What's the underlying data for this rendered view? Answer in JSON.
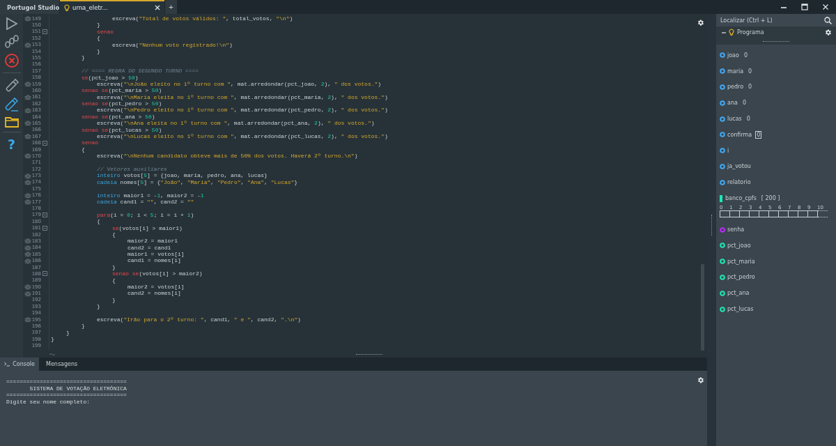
{
  "tabs": [
    {
      "label": "Portugol Studio",
      "kind": "home",
      "selected": false,
      "closable": false
    },
    {
      "label": "urna_eletr...",
      "kind": "file",
      "selected": true,
      "closable": true
    }
  ],
  "new_tab_label": "+",
  "toolbar": {
    "help_label": "?"
  },
  "editor": {
    "lines": [
      {
        "number": "149",
        "breakpoint": true,
        "fold": false,
        "tokens": [
          {
            "kind": "plain",
            "text": "\t\t\t\tescreva("
          },
          {
            "kind": "str",
            "text": "\"Total de votos válidos: \""
          },
          {
            "kind": "plain",
            "text": ", total_votos, "
          },
          {
            "kind": "str",
            "text": "\"\\n\""
          },
          {
            "kind": "plain",
            "text": ")"
          }
        ]
      },
      {
        "number": "150",
        "breakpoint": false,
        "fold": false,
        "tokens": [
          {
            "kind": "plain",
            "text": "\t\t\t}"
          }
        ]
      },
      {
        "number": "151",
        "breakpoint": false,
        "fold": true,
        "tokens": [
          {
            "kind": "kw",
            "text": "\t\t\tsenao"
          }
        ]
      },
      {
        "number": "152",
        "breakpoint": false,
        "fold": false,
        "tokens": [
          {
            "kind": "plain",
            "text": "\t\t\t{"
          }
        ]
      },
      {
        "number": "153",
        "breakpoint": true,
        "fold": false,
        "tokens": [
          {
            "kind": "plain",
            "text": "\t\t\t\tescreva("
          },
          {
            "kind": "str",
            "text": "\"Nenhum voto registrado!\\n\""
          },
          {
            "kind": "plain",
            "text": ")"
          }
        ]
      },
      {
        "number": "154",
        "breakpoint": false,
        "fold": false,
        "tokens": [
          {
            "kind": "plain",
            "text": "\t\t\t}"
          }
        ]
      },
      {
        "number": "155",
        "breakpoint": false,
        "fold": false,
        "tokens": [
          {
            "kind": "plain",
            "text": "\t\t}"
          }
        ]
      },
      {
        "number": "156",
        "breakpoint": false,
        "fold": false
      },
      {
        "number": "157",
        "breakpoint": false,
        "fold": false,
        "tokens": [
          {
            "kind": "comment",
            "text": "\t\t// ==== REGRA DO SEGUNDO TURNO ===="
          }
        ]
      },
      {
        "number": "158",
        "breakpoint": false,
        "fold": false,
        "tokens": [
          {
            "kind": "kw",
            "text": "\t\tse"
          },
          {
            "kind": "plain",
            "text": "(pct_joao > "
          },
          {
            "kind": "num",
            "text": "50"
          },
          {
            "kind": "plain",
            "text": ")"
          }
        ]
      },
      {
        "number": "159",
        "breakpoint": true,
        "fold": false,
        "tokens": [
          {
            "kind": "plain",
            "text": "\t\t\tescreva("
          },
          {
            "kind": "str",
            "text": "\"\\nJoão eleito no 1º turno com \""
          },
          {
            "kind": "plain",
            "text": ", mat.arredondar(pct_joao, "
          },
          {
            "kind": "num",
            "text": "2"
          },
          {
            "kind": "plain",
            "text": "), "
          },
          {
            "kind": "str",
            "text": "\" dos votos.\""
          },
          {
            "kind": "plain",
            "text": ")"
          }
        ]
      },
      {
        "number": "160",
        "breakpoint": false,
        "fold": false,
        "tokens": [
          {
            "kind": "kw",
            "text": "\t\tsenao se"
          },
          {
            "kind": "plain",
            "text": "(pct_maria > "
          },
          {
            "kind": "num",
            "text": "50"
          },
          {
            "kind": "plain",
            "text": ")"
          }
        ]
      },
      {
        "number": "161",
        "breakpoint": true,
        "fold": false,
        "tokens": [
          {
            "kind": "plain",
            "text": "\t\t\tescreva("
          },
          {
            "kind": "str",
            "text": "\"\\nMaria eleita no 1º turno com \""
          },
          {
            "kind": "plain",
            "text": ", mat.arredondar(pct_maria, "
          },
          {
            "kind": "num",
            "text": "2"
          },
          {
            "kind": "plain",
            "text": "), "
          },
          {
            "kind": "str",
            "text": "\" dos votos.\""
          },
          {
            "kind": "plain",
            "text": ")"
          }
        ]
      },
      {
        "number": "162",
        "breakpoint": false,
        "fold": false,
        "tokens": [
          {
            "kind": "kw",
            "text": "\t\tsenao se"
          },
          {
            "kind": "plain",
            "text": "(pct_pedro > "
          },
          {
            "kind": "num",
            "text": "50"
          },
          {
            "kind": "plain",
            "text": ")"
          }
        ]
      },
      {
        "number": "163",
        "breakpoint": true,
        "fold": false,
        "tokens": [
          {
            "kind": "plain",
            "text": "\t\t\tescreva("
          },
          {
            "kind": "str",
            "text": "\"\\nPedro eleito no 1º turno com \""
          },
          {
            "kind": "plain",
            "text": ", mat.arredondar(pct_pedro, "
          },
          {
            "kind": "num",
            "text": "2"
          },
          {
            "kind": "plain",
            "text": "), "
          },
          {
            "kind": "str",
            "text": "\" dos votos.\""
          },
          {
            "kind": "plain",
            "text": ")"
          }
        ]
      },
      {
        "number": "164",
        "breakpoint": false,
        "fold": false,
        "tokens": [
          {
            "kind": "kw",
            "text": "\t\tsenao se"
          },
          {
            "kind": "plain",
            "text": "(pct_ana > "
          },
          {
            "kind": "num",
            "text": "50"
          },
          {
            "kind": "plain",
            "text": ")"
          }
        ]
      },
      {
        "number": "165",
        "breakpoint": true,
        "fold": false,
        "tokens": [
          {
            "kind": "plain",
            "text": "\t\t\tescreva("
          },
          {
            "kind": "str",
            "text": "\"\\nAna eleita no 1º turno com \""
          },
          {
            "kind": "plain",
            "text": ", mat.arredondar(pct_ana, "
          },
          {
            "kind": "num",
            "text": "2"
          },
          {
            "kind": "plain",
            "text": "), "
          },
          {
            "kind": "str",
            "text": "\" dos votos.\""
          },
          {
            "kind": "plain",
            "text": ")"
          }
        ]
      },
      {
        "number": "166",
        "breakpoint": false,
        "fold": false,
        "tokens": [
          {
            "kind": "kw",
            "text": "\t\tsenao se"
          },
          {
            "kind": "plain",
            "text": "(pct_lucas > "
          },
          {
            "kind": "num",
            "text": "50"
          },
          {
            "kind": "plain",
            "text": ")"
          }
        ]
      },
      {
        "number": "167",
        "breakpoint": true,
        "fold": false,
        "tokens": [
          {
            "kind": "plain",
            "text": "\t\t\tescreva("
          },
          {
            "kind": "str",
            "text": "\"\\nLucas eleito no 1º turno com \""
          },
          {
            "kind": "plain",
            "text": ", mat.arredondar(pct_lucas, "
          },
          {
            "kind": "num",
            "text": "2"
          },
          {
            "kind": "plain",
            "text": "), "
          },
          {
            "kind": "str",
            "text": "\" dos votos.\""
          },
          {
            "kind": "plain",
            "text": ")"
          }
        ]
      },
      {
        "number": "168",
        "breakpoint": false,
        "fold": true,
        "tokens": [
          {
            "kind": "kw",
            "text": "\t\tsenao"
          }
        ]
      },
      {
        "number": "169",
        "breakpoint": false,
        "fold": false,
        "tokens": [
          {
            "kind": "plain",
            "text": "\t\t{"
          }
        ]
      },
      {
        "number": "170",
        "breakpoint": true,
        "fold": false,
        "tokens": [
          {
            "kind": "plain",
            "text": "\t\t\tescreva("
          },
          {
            "kind": "str",
            "text": "\"\\nNenhum candidato obteve mais de 50% dos votos. Haverá 2º turno.\\n\""
          },
          {
            "kind": "plain",
            "text": ")"
          }
        ]
      },
      {
        "number": "171",
        "breakpoint": false,
        "fold": false
      },
      {
        "number": "172",
        "breakpoint": false,
        "fold": false,
        "tokens": [
          {
            "kind": "comment",
            "text": "\t\t\t// Vetores auxiliares"
          }
        ]
      },
      {
        "number": "173",
        "breakpoint": true,
        "fold": false,
        "tokens": [
          {
            "kind": "type",
            "text": "\t\t\tinteiro"
          },
          {
            "kind": "plain",
            "text": " votos["
          },
          {
            "kind": "num",
            "text": "5"
          },
          {
            "kind": "plain",
            "text": "] = {joao, maria, pedro, ana, lucas}"
          }
        ]
      },
      {
        "number": "174",
        "breakpoint": true,
        "fold": false,
        "tokens": [
          {
            "kind": "type",
            "text": "\t\t\tcadeia"
          },
          {
            "kind": "plain",
            "text": " nomes["
          },
          {
            "kind": "num",
            "text": "5"
          },
          {
            "kind": "plain",
            "text": "] = {"
          },
          {
            "kind": "str",
            "text": "\"João\""
          },
          {
            "kind": "plain",
            "text": ", "
          },
          {
            "kind": "str",
            "text": "\"Maria\""
          },
          {
            "kind": "plain",
            "text": ", "
          },
          {
            "kind": "str",
            "text": "\"Pedro\""
          },
          {
            "kind": "plain",
            "text": ", "
          },
          {
            "kind": "str",
            "text": "\"Ana\""
          },
          {
            "kind": "plain",
            "text": ", "
          },
          {
            "kind": "str",
            "text": "\"Lucas\""
          },
          {
            "kind": "plain",
            "text": "}"
          }
        ]
      },
      {
        "number": "175",
        "breakpoint": false,
        "fold": false
      },
      {
        "number": "176",
        "breakpoint": true,
        "fold": false,
        "tokens": [
          {
            "kind": "type",
            "text": "\t\t\tinteiro"
          },
          {
            "kind": "plain",
            "text": " maior1 = -"
          },
          {
            "kind": "num",
            "text": "1"
          },
          {
            "kind": "plain",
            "text": ", maior2 = -"
          },
          {
            "kind": "num",
            "text": "1"
          }
        ]
      },
      {
        "number": "177",
        "breakpoint": true,
        "fold": false,
        "tokens": [
          {
            "kind": "type",
            "text": "\t\t\tcadeia"
          },
          {
            "kind": "plain",
            "text": " cand1 = "
          },
          {
            "kind": "str",
            "text": "\"\""
          },
          {
            "kind": "plain",
            "text": ", cand2 = "
          },
          {
            "kind": "str",
            "text": "\"\""
          }
        ]
      },
      {
        "number": "178",
        "breakpoint": false,
        "fold": false
      },
      {
        "number": "179",
        "breakpoint": false,
        "fold": true,
        "tokens": [
          {
            "kind": "kw",
            "text": "\t\t\tpara"
          },
          {
            "kind": "plain",
            "text": "(i = "
          },
          {
            "kind": "num",
            "text": "0"
          },
          {
            "kind": "plain",
            "text": "; i < "
          },
          {
            "kind": "num",
            "text": "5"
          },
          {
            "kind": "plain",
            "text": "; i = i + "
          },
          {
            "kind": "num",
            "text": "1"
          },
          {
            "kind": "plain",
            "text": ")"
          }
        ]
      },
      {
        "number": "180",
        "breakpoint": false,
        "fold": false,
        "tokens": [
          {
            "kind": "plain",
            "text": "\t\t\t{"
          }
        ]
      },
      {
        "number": "181",
        "breakpoint": false,
        "fold": true,
        "tokens": [
          {
            "kind": "kw",
            "text": "\t\t\t\tse"
          },
          {
            "kind": "plain",
            "text": "(votos[i] > maior1)"
          }
        ]
      },
      {
        "number": "182",
        "breakpoint": false,
        "fold": false,
        "tokens": [
          {
            "kind": "plain",
            "text": "\t\t\t\t{"
          }
        ]
      },
      {
        "number": "183",
        "breakpoint": true,
        "fold": false,
        "tokens": [
          {
            "kind": "plain",
            "text": "\t\t\t\t\tmaior2 = maior1"
          }
        ]
      },
      {
        "number": "184",
        "breakpoint": true,
        "fold": false,
        "tokens": [
          {
            "kind": "plain",
            "text": "\t\t\t\t\tcand2 = cand1"
          }
        ]
      },
      {
        "number": "185",
        "breakpoint": true,
        "fold": false,
        "tokens": [
          {
            "kind": "plain",
            "text": "\t\t\t\t\tmaior1 = votos[i]"
          }
        ]
      },
      {
        "number": "186",
        "breakpoint": true,
        "fold": false,
        "tokens": [
          {
            "kind": "plain",
            "text": "\t\t\t\t\tcand1 = nomes[i]"
          }
        ]
      },
      {
        "number": "187",
        "breakpoint": false,
        "fold": false,
        "tokens": [
          {
            "kind": "plain",
            "text": "\t\t\t\t}"
          }
        ]
      },
      {
        "number": "188",
        "breakpoint": false,
        "fold": true,
        "tokens": [
          {
            "kind": "kw",
            "text": "\t\t\t\tsenao se"
          },
          {
            "kind": "plain",
            "text": "(votos[i] > maior2)"
          }
        ]
      },
      {
        "number": "189",
        "breakpoint": false,
        "fold": false,
        "tokens": [
          {
            "kind": "plain",
            "text": "\t\t\t\t{"
          }
        ]
      },
      {
        "number": "190",
        "breakpoint": true,
        "fold": false,
        "tokens": [
          {
            "kind": "plain",
            "text": "\t\t\t\t\tmaior2 = votos[i]"
          }
        ]
      },
      {
        "number": "191",
        "breakpoint": true,
        "fold": false,
        "tokens": [
          {
            "kind": "plain",
            "text": "\t\t\t\t\tcand2 = nomes[i]"
          }
        ]
      },
      {
        "number": "192",
        "breakpoint": false,
        "fold": false,
        "tokens": [
          {
            "kind": "plain",
            "text": "\t\t\t\t}"
          }
        ]
      },
      {
        "number": "193",
        "breakpoint": false,
        "fold": false,
        "tokens": [
          {
            "kind": "plain",
            "text": "\t\t\t}"
          }
        ]
      },
      {
        "number": "194",
        "breakpoint": false,
        "fold": false
      },
      {
        "number": "195",
        "breakpoint": true,
        "fold": false,
        "tokens": [
          {
            "kind": "plain",
            "text": "\t\t\tescreva("
          },
          {
            "kind": "str",
            "text": "\"Irão para o 2º turno: \""
          },
          {
            "kind": "plain",
            "text": ", cand1, "
          },
          {
            "kind": "str",
            "text": "\" e \""
          },
          {
            "kind": "plain",
            "text": ", cand2, "
          },
          {
            "kind": "str",
            "text": "\".\\n\""
          },
          {
            "kind": "plain",
            "text": ")"
          }
        ]
      },
      {
        "number": "196",
        "breakpoint": false,
        "fold": false,
        "tokens": [
          {
            "kind": "plain",
            "text": "\t\t}"
          }
        ]
      },
      {
        "number": "197",
        "breakpoint": false,
        "fold": false,
        "tokens": [
          {
            "kind": "plain",
            "text": "\t}"
          }
        ]
      },
      {
        "number": "198",
        "breakpoint": false,
        "fold": false,
        "tokens": [
          {
            "kind": "plain",
            "text": "}"
          }
        ]
      },
      {
        "number": "199",
        "breakpoint": false,
        "fold": false
      }
    ]
  },
  "bottom_tabs": [
    {
      "label": "Console",
      "kind": "console",
      "selected": true
    },
    {
      "label": "Mensagens",
      "kind": "messages",
      "selected": false
    }
  ],
  "console": {
    "lines": [
      "====================================",
      "       SISTEMA DE VOTAÇÃO ELETRÔNICA",
      "====================================",
      "Digite seu nome completo:"
    ]
  },
  "inspector": {
    "search": {
      "placeholder": "Localizar (Ctrl + L)"
    },
    "tree_root": "Programa",
    "variables": [
      {
        "kind": "scalar",
        "name": "joao",
        "value": "0",
        "boxed": false,
        "color": "#3fa9f5"
      },
      {
        "kind": "scalar",
        "name": "maria",
        "value": "0",
        "boxed": false,
        "color": "#3fa9f5"
      },
      {
        "kind": "scalar",
        "name": "pedro",
        "value": "0",
        "boxed": false,
        "color": "#3fa9f5"
      },
      {
        "kind": "scalar",
        "name": "ana",
        "value": "0",
        "boxed": false,
        "color": "#3fa9f5"
      },
      {
        "kind": "scalar",
        "name": "lucas",
        "value": "0",
        "boxed": false,
        "color": "#3fa9f5"
      },
      {
        "kind": "scalar",
        "name": "confirma",
        "value": "0",
        "boxed": true,
        "color": "#3fa9f5"
      },
      {
        "kind": "scalar",
        "name": "i",
        "color": "#3fa9f5"
      },
      {
        "kind": "scalar",
        "name": "ja_votou",
        "color": "#3fa9f5"
      },
      {
        "kind": "scalar",
        "name": "relatorio",
        "color": "#3fa9f5"
      },
      {
        "kind": "array",
        "name": "banco_cpfs",
        "size": "[ 200 ]",
        "indices": [
          "0",
          "1",
          "2",
          "3",
          "4",
          "5",
          "6",
          "7",
          "8",
          "9",
          "10"
        ],
        "color": "#1de9b6"
      },
      {
        "kind": "scalar",
        "name": "senha",
        "color": "#c026ff"
      },
      {
        "kind": "scalar",
        "name": "pct_joao",
        "color": "#1de9b6"
      },
      {
        "kind": "scalar",
        "name": "pct_maria",
        "color": "#1de9b6"
      },
      {
        "kind": "scalar",
        "name": "pct_pedro",
        "color": "#1de9b6"
      },
      {
        "kind": "scalar",
        "name": "pct_ana",
        "color": "#1de9b6"
      },
      {
        "kind": "scalar",
        "name": "pct_lucas",
        "color": "#1de9b6"
      }
    ]
  }
}
